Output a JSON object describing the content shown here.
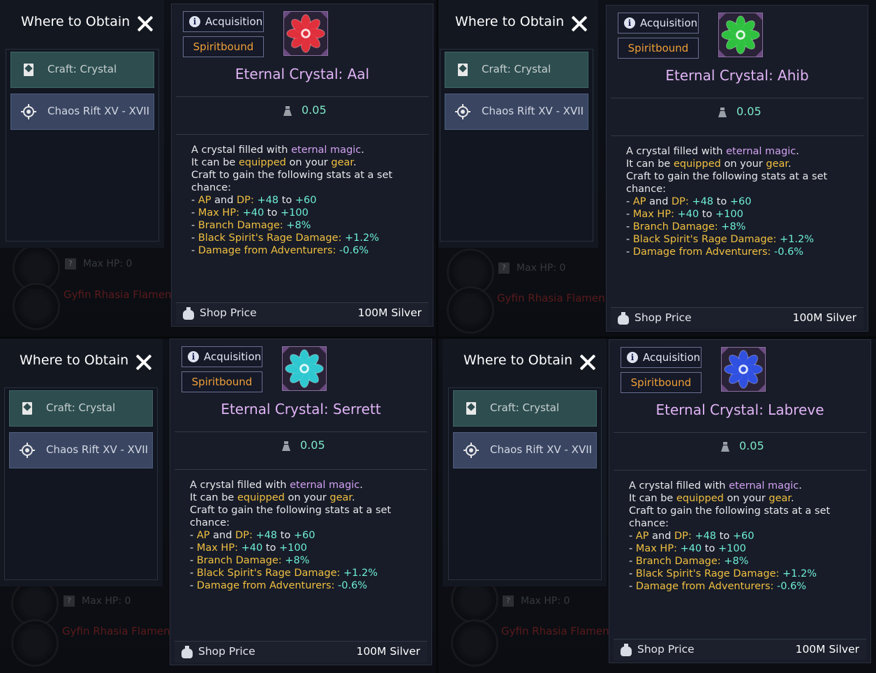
{
  "common": {
    "where_title": "Where to Obtain",
    "craft_label": "Craft: Crystal",
    "rift_label": "Chaos Rift XV - XVII",
    "acquisition_label": "Acquisition",
    "spiritbound_label": "Spiritbound",
    "weight": "0.05",
    "desc": {
      "l1a": "A crystal filled with ",
      "l1b": "eternal magic",
      "l1c": ".",
      "l2a": "It can be ",
      "l2b": "equipped",
      "l2c": " on your ",
      "l2d": "gear",
      "l2e": ".",
      "l3": "Craft to gain the following stats at a set",
      "l4": "chance:",
      "s1a": "- ",
      "s1b": "AP",
      "s1c": " and ",
      "s1d": "DP",
      "s1e": ": ",
      "s1f": "+48",
      "s1g": " to ",
      "s1h": "+60",
      "s2b": "Max HP",
      "s2e": ": ",
      "s2f": "+40",
      "s2g": " to ",
      "s2h": "+100",
      "s3b": "Branch Damage",
      "s3e": ": ",
      "s3f": "+8%",
      "s4b": "Black Spirit's Rage Damage",
      "s4e": ": ",
      "s4f": "+1.2%",
      "s5b": "Damage from Adventurers",
      "s5e": ": ",
      "s5f": "-0.6%"
    },
    "shop_label": "Shop Price",
    "shop_price": "100M Silver",
    "bg_maxhp": "Max HP: 0",
    "bg_name": "Gyfin Rhasia Flamen",
    "bg_q": "?"
  },
  "items": [
    {
      "title": "Eternal Crystal: Aal",
      "gem_color": "#e0303c"
    },
    {
      "title": "Eternal Crystal: Ahib",
      "gem_color": "#30c040"
    },
    {
      "title": "Eternal Crystal: Serrett",
      "gem_color": "#30c8d0"
    },
    {
      "title": "Eternal Crystal: Labreve",
      "gem_color": "#3050e0"
    }
  ]
}
